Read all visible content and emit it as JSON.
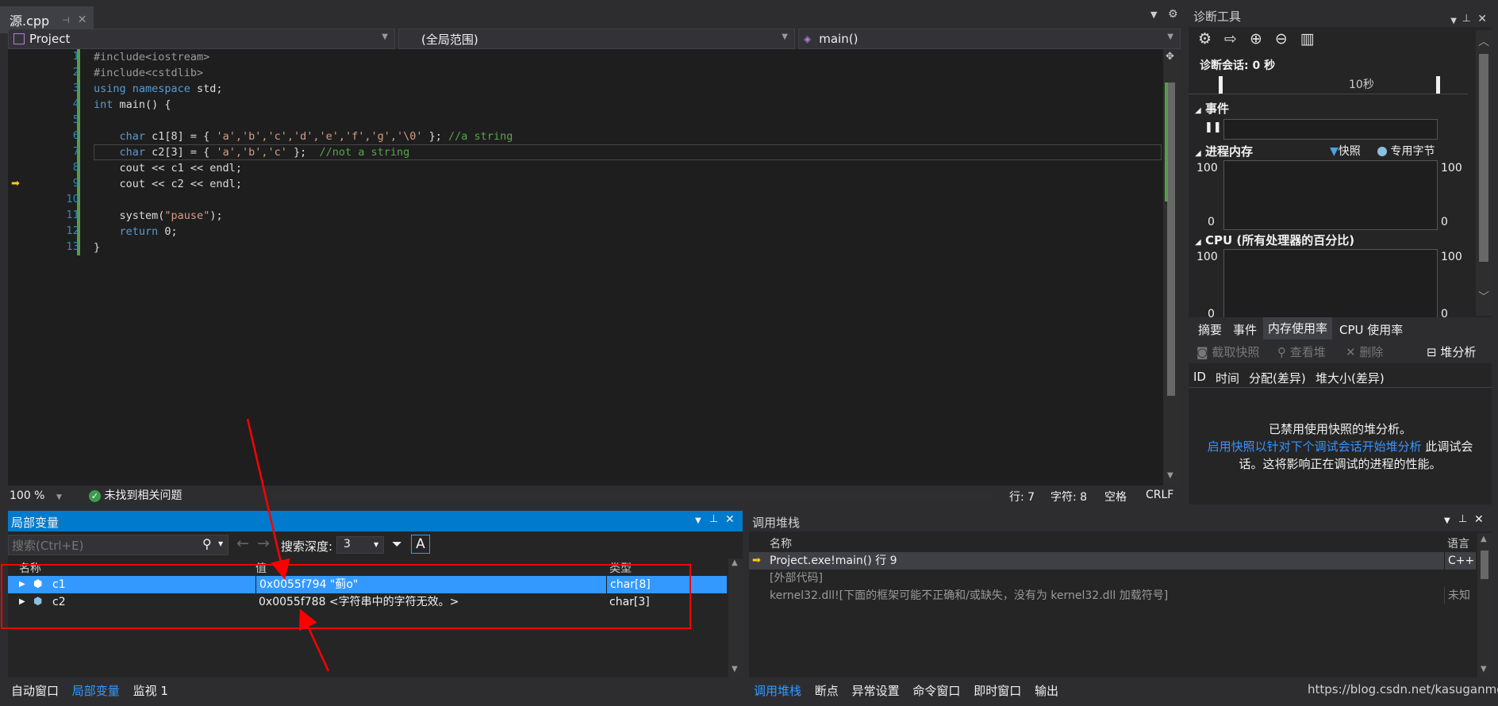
{
  "editor": {
    "tab_title": "源.cpp",
    "project_combo": "Project",
    "scope_combo": "(全局范围)",
    "function_combo": "main()",
    "lines": [
      "1",
      "2",
      "3",
      "4",
      "5",
      "6",
      "7",
      "8",
      "9",
      "10",
      "11",
      "12",
      "13"
    ],
    "code": {
      "l1": "#include<iostream>",
      "l2": "#include<cstdlib>",
      "l3a": "using namespace",
      "l3b": " std;",
      "l4a": "int",
      "l4b": " main() {",
      "l6a": "char",
      "l6b": " c1[8] = { ",
      "l6c": "'a','b','c','d','e','f','g','\\0'",
      "l6d": " }; ",
      "l6e": "//a string",
      "l7a": "char",
      "l7b": " c2[3] = { ",
      "l7c": "'a','b','c'",
      "l7d": " };  ",
      "l7e": "//not a string",
      "l8": "cout << c1 << endl;",
      "l9": "cout << c2 << endl;",
      "l11a": "system(",
      "l11b": "\"pause\"",
      "l11c": ");",
      "l12a": "return",
      "l12b": " 0;",
      "l13": "}"
    },
    "zoom": "100 %",
    "issues": "未找到相关问题",
    "status_line": "行: 7",
    "status_char": "字符: 8",
    "status_space": "空格",
    "status_eol": "CRLF"
  },
  "diag": {
    "title": "诊断工具",
    "session": "诊断会话: 0 秒",
    "timeline_label": "10秒",
    "events": "事件",
    "process_memory": "进程内存",
    "legend_snapshot": "快照",
    "legend_private": "专用字节",
    "mem_max_left": "100",
    "mem_min_left": "0",
    "mem_max_right": "100",
    "mem_min_right": "0",
    "cpu": "CPU (所有处理器的百分比)",
    "cpu_max_left": "100",
    "cpu_max_right": "100",
    "cpu_min_left": "0",
    "cpu_min_right": "0",
    "tabs": [
      "摘要",
      "事件",
      "内存使用率",
      "CPU 使用率"
    ],
    "btn_snapshot": "截取快照",
    "btn_view_heap": "查看堆",
    "btn_delete": "删除",
    "btn_heap_analysis": "堆分析",
    "cols": [
      "ID",
      "时间",
      "分配(差异)",
      "堆大小(差异)"
    ],
    "msg1": "已禁用使用快照的堆分析。",
    "msg2_link": "启用快照以针对下个调试会话开始堆分析",
    "msg2_rest": " 此调试会",
    "msg3": "话。这将影响正在调试的进程的性能。"
  },
  "locals": {
    "title": "局部变量",
    "search_placeholder": "搜索(Ctrl+E)",
    "search_depth_label": "搜索深度:",
    "search_depth_value": "3",
    "col_name": "名称",
    "col_value": "值",
    "col_type": "类型",
    "rows": [
      {
        "name": "c1",
        "value": "0x0055f794 \"蓟o\"",
        "type": "char[8]"
      },
      {
        "name": "c2",
        "value": "0x0055f788 <字符串中的字符无效。>",
        "type": "char[3]"
      }
    ],
    "bottom_tabs": [
      "自动窗口",
      "局部变量",
      "监视 1"
    ]
  },
  "callstack": {
    "title": "调用堆栈",
    "col_name": "名称",
    "col_lang": "语言",
    "rows": [
      {
        "name": "Project.exe!main() 行 9",
        "lang": "C++"
      },
      {
        "name": "[外部代码]",
        "lang": ""
      },
      {
        "name": "kernel32.dll![下面的框架可能不正确和/或缺失，没有为 kernel32.dll 加载符号]",
        "lang": "未知"
      }
    ],
    "bottom_tabs": [
      "调用堆栈",
      "断点",
      "异常设置",
      "命令窗口",
      "即时窗口",
      "输出"
    ],
    "watermark": "https://blog.csdn.net/kasuganmo"
  },
  "colors": {
    "accent": "#007acc",
    "selection": "#3399ff",
    "annotation": "#ff0000"
  }
}
